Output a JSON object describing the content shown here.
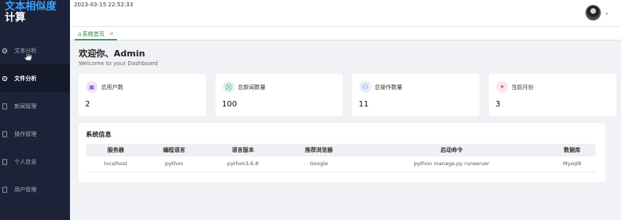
{
  "brand": {
    "line1": "文本相似度",
    "line2": "计算"
  },
  "sidebar": {
    "items": [
      {
        "label": "文本分析",
        "icon": "gear-icon",
        "active": false
      },
      {
        "label": "文件分析",
        "icon": "gear-icon",
        "active": true
      },
      {
        "label": "新闻管理",
        "icon": "doc-icon",
        "active": false
      },
      {
        "label": "操作管理",
        "icon": "doc-icon",
        "active": false
      },
      {
        "label": "个人信息",
        "icon": "doc-icon",
        "active": false
      },
      {
        "label": "用户管理",
        "icon": "doc-icon",
        "active": false
      }
    ]
  },
  "topbar": {
    "datetime": "2023-03-15 22:52:33",
    "user_menu_caret": "⌄"
  },
  "tabs": [
    {
      "label": "系统首页",
      "close": "✕"
    }
  ],
  "welcome": {
    "title": "欢迎你、Admin",
    "subtitle": "Welcome to your Dashboard"
  },
  "stats": [
    {
      "label": "总用户数",
      "value": "2",
      "icon": "user-icon",
      "color": "#8e5bd6",
      "bg": "#efe6fb"
    },
    {
      "label": "总新闻数量",
      "value": "100",
      "icon": "cart-icon",
      "color": "#2fa36b",
      "bg": "#e2f5ea"
    },
    {
      "label": "总操作数量",
      "value": "11",
      "icon": "users-icon",
      "color": "#4a7fd0",
      "bg": "#e3edfb"
    },
    {
      "label": "当前月份",
      "value": "3",
      "icon": "puzzle-icon",
      "color": "#d6477a",
      "bg": "#fbe5ee"
    }
  ],
  "sysinfo": {
    "title": "系统信息",
    "headers": [
      "服务器",
      "编程语言",
      "语言版本",
      "推荐浏览器",
      "启动命令",
      "数据库"
    ],
    "row": [
      "localhost",
      "python",
      "python3.6.8",
      "Google",
      "python manage.py runserver",
      "Mysql8"
    ]
  }
}
